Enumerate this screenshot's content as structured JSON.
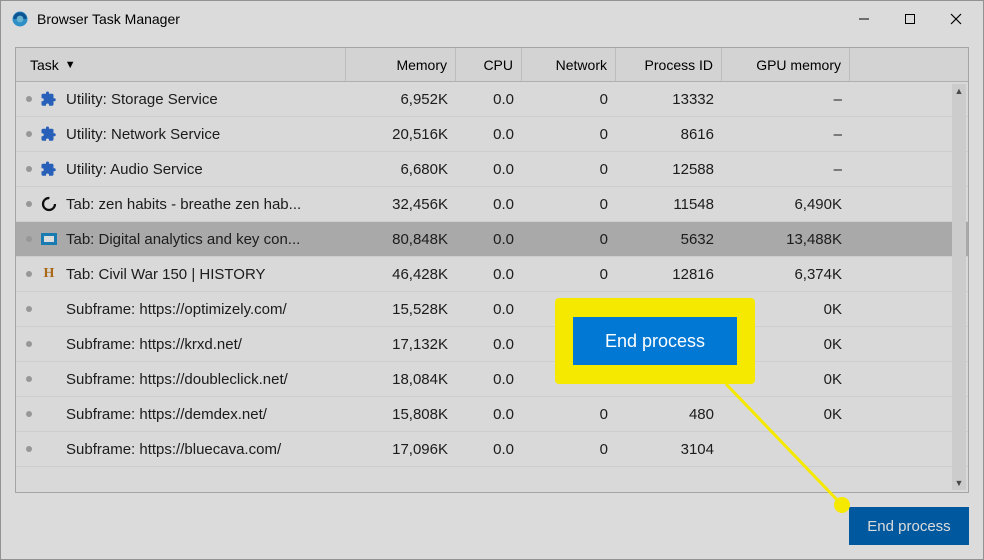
{
  "window": {
    "title": "Browser Task Manager"
  },
  "columns": {
    "task": "Task",
    "memory": "Memory",
    "cpu": "CPU",
    "network": "Network",
    "pid": "Process ID",
    "gpu": "GPU memory",
    "sort_indicator": "▼"
  },
  "rows": [
    {
      "icon": "puzzle",
      "name": "Utility: Storage Service",
      "memory": "6,952K",
      "cpu": "0.0",
      "network": "0",
      "pid": "13332",
      "gpu": "–",
      "selected": false
    },
    {
      "icon": "puzzle",
      "name": "Utility: Network Service",
      "memory": "20,516K",
      "cpu": "0.0",
      "network": "0",
      "pid": "8616",
      "gpu": "–",
      "selected": false
    },
    {
      "icon": "puzzle",
      "name": "Utility: Audio Service",
      "memory": "6,680K",
      "cpu": "0.0",
      "network": "0",
      "pid": "12588",
      "gpu": "–",
      "selected": false
    },
    {
      "icon": "spinner",
      "name": "Tab: zen habits - breathe zen hab...",
      "memory": "32,456K",
      "cpu": "0.0",
      "network": "0",
      "pid": "11548",
      "gpu": "6,490K",
      "selected": false
    },
    {
      "icon": "picture",
      "name": "Tab: Digital analytics and key con...",
      "memory": "80,848K",
      "cpu": "0.0",
      "network": "0",
      "pid": "5632",
      "gpu": "13,488K",
      "selected": true
    },
    {
      "icon": "history",
      "name": "Tab: Civil War 150 | HISTORY",
      "memory": "46,428K",
      "cpu": "0.0",
      "network": "0",
      "pid": "12816",
      "gpu": "6,374K",
      "selected": false
    },
    {
      "icon": "",
      "name": "Subframe: https://optimizely.com/",
      "memory": "15,528K",
      "cpu": "0.0",
      "network": "",
      "pid": "",
      "gpu": "0K",
      "selected": false
    },
    {
      "icon": "",
      "name": "Subframe: https://krxd.net/",
      "memory": "17,132K",
      "cpu": "0.0",
      "network": "",
      "pid": "",
      "gpu": "0K",
      "selected": false
    },
    {
      "icon": "",
      "name": "Subframe: https://doubleclick.net/",
      "memory": "18,084K",
      "cpu": "0.0",
      "network": "",
      "pid": "",
      "gpu": "0K",
      "selected": false
    },
    {
      "icon": "",
      "name": "Subframe: https://demdex.net/",
      "memory": "15,808K",
      "cpu": "0.0",
      "network": "0",
      "pid": "480",
      "gpu": "0K",
      "selected": false
    },
    {
      "icon": "",
      "name": "Subframe: https://bluecava.com/",
      "memory": "17,096K",
      "cpu": "0.0",
      "network": "0",
      "pid": "3104",
      "gpu": "",
      "selected": false
    }
  ],
  "buttons": {
    "end_process": "End process"
  },
  "callout": {
    "label": "End process"
  }
}
